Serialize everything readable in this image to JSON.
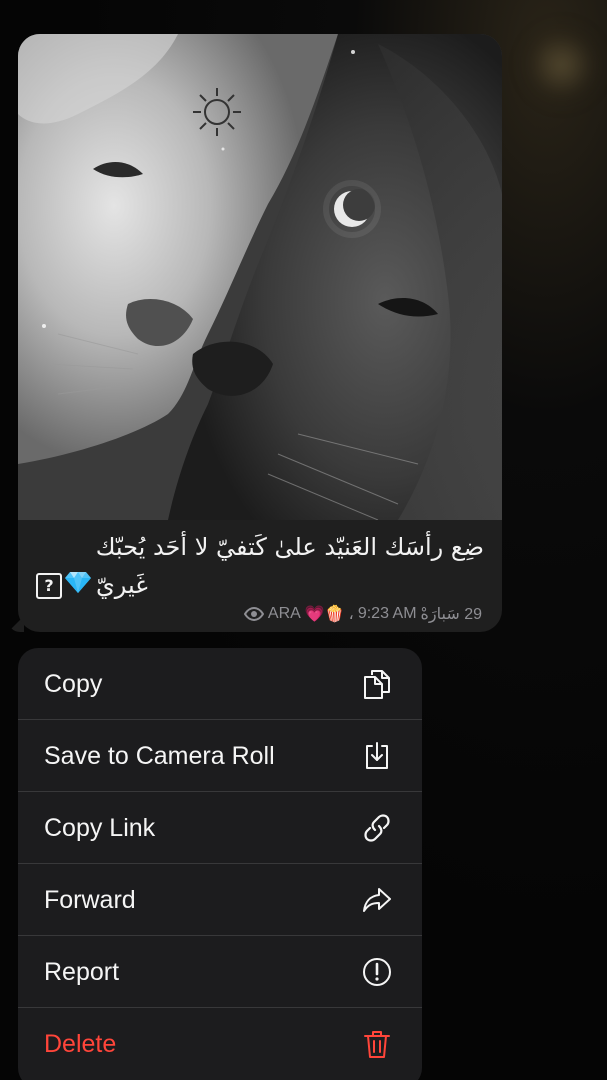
{
  "message": {
    "caption_line1": "ضِع رأسَك العَنيّد علىٰ كَتفيّ لا أحَد يُحبّك",
    "caption_line2": "غَيريّ",
    "question_glyph": "?",
    "emoji_gem": "gem-icon",
    "meta": {
      "views_icon": "eye-icon",
      "author": "ARA",
      "author_emojis": "💗🍿",
      "separator": "،",
      "time": "9:23 AM",
      "extra": "29 سَبارَهْ"
    }
  },
  "menu": {
    "items": [
      {
        "label": "Copy",
        "icon": "copy-icon"
      },
      {
        "label": "Save to Camera Roll",
        "icon": "save-download-icon"
      },
      {
        "label": "Copy Link",
        "icon": "link-icon"
      },
      {
        "label": "Forward",
        "icon": "forward-arrow-icon"
      },
      {
        "label": "Report",
        "icon": "report-exclamation-icon"
      },
      {
        "label": "Delete",
        "icon": "trash-icon"
      }
    ]
  },
  "colors": {
    "background": "#050505",
    "bubble": "#1f1f1f",
    "menu": "#1c1c1e",
    "text": "#f5f5f5",
    "meta_text": "#8e8e93",
    "danger": "#ff453a"
  }
}
